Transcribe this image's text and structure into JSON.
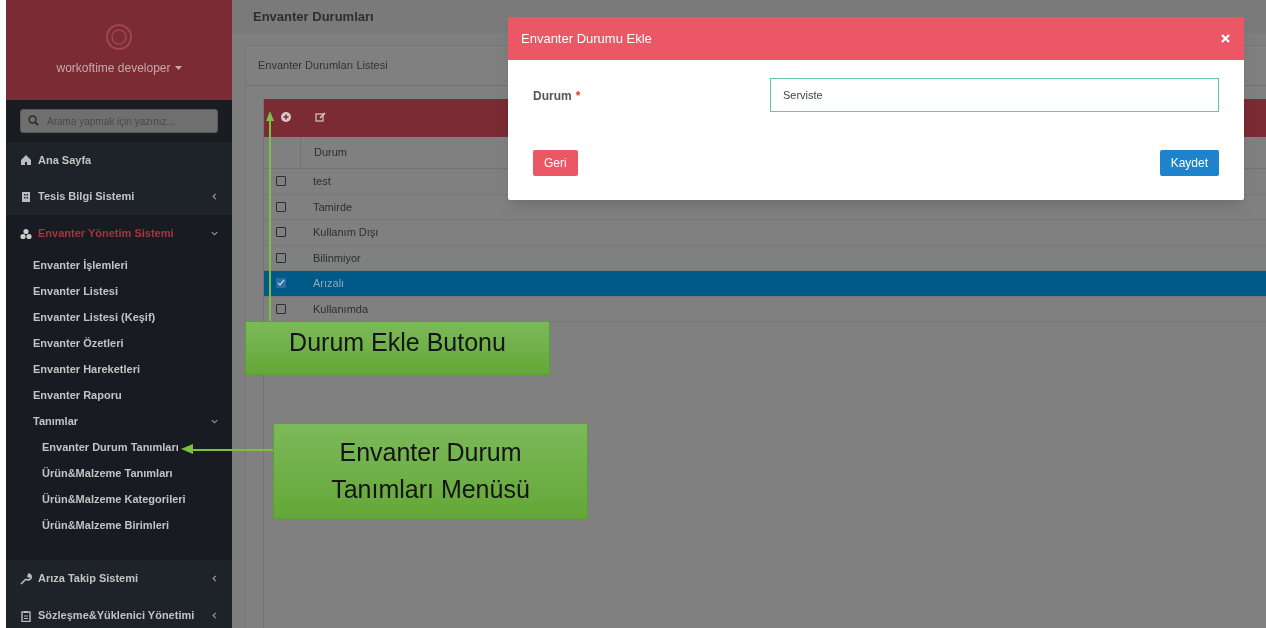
{
  "page_title": "Envanter Durumları",
  "sidebar": {
    "user": "workoftime developer",
    "search_placeholder": "Arama yapmak için yazınız...",
    "items": [
      {
        "label": "Ana Sayfa",
        "kind": "link",
        "active": false
      },
      {
        "label": "Tesis Bilgi Sistemi",
        "kind": "menu",
        "active": false,
        "expanded": false
      },
      {
        "label": "Envanter Yönetim Sistemi",
        "kind": "menu",
        "active": true,
        "expanded": true,
        "children": [
          {
            "label": "Envanter İşlemleri"
          },
          {
            "label": "Envanter Listesi"
          },
          {
            "label": "Envanter Listesi (Keşif)"
          },
          {
            "label": "Envanter Özetleri"
          },
          {
            "label": "Envanter Hareketleri"
          },
          {
            "label": "Envanter Raporu"
          },
          {
            "label": "Tanımlar",
            "expanded": true,
            "children": [
              {
                "label": "Envanter Durum Tanımları"
              },
              {
                "label": "Ürün&Malzeme Tanımları"
              },
              {
                "label": "Ürün&Malzeme Kategorileri"
              },
              {
                "label": "Ürün&Malzeme Birimleri"
              }
            ]
          }
        ]
      },
      {
        "label": "Arıza Takip Sistemi",
        "kind": "menu",
        "active": false,
        "expanded": false
      },
      {
        "label": "Sözleşme&Yüklenici Yönetimi",
        "kind": "menu",
        "active": false,
        "expanded": false
      }
    ]
  },
  "panel": {
    "title": "Envanter Durumları Listesi",
    "table": {
      "columns": [
        "Durum"
      ],
      "rows": [
        {
          "label": "test",
          "checked": false,
          "selected": false
        },
        {
          "label": "Tamirde",
          "checked": false,
          "selected": false
        },
        {
          "label": "Kullanım Dışı",
          "checked": false,
          "selected": false
        },
        {
          "label": "Bilinmiyor",
          "checked": false,
          "selected": false
        },
        {
          "label": "Arızalı",
          "checked": true,
          "selected": true
        },
        {
          "label": "Kullanımda",
          "checked": false,
          "selected": false
        }
      ]
    }
  },
  "modal": {
    "title": "Envanter Durumu Ekle",
    "field": {
      "label": "Durum",
      "required": true,
      "required_mark": "*",
      "value": "Serviste"
    },
    "buttons": [
      "Geri",
      "Kaydet"
    ]
  },
  "callouts": [
    {
      "text": "Durum Ekle Butonu"
    },
    {
      "text": "Envanter Durum Tanımları Menüsü"
    }
  ]
}
